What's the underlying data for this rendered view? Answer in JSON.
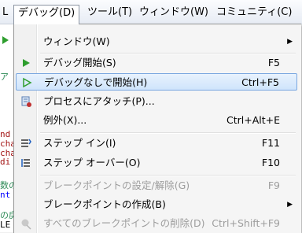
{
  "menubar": {
    "items": [
      "デバッグ(D)",
      "ツール(T)",
      "ウィンドウ(W)",
      "コミュニティ(C)"
    ],
    "partial_left": "L"
  },
  "editor_fragments": [
    "ア",
    "nd",
    "cha",
    "cha",
    "di",
    "数の",
    "nt",
    "の戻",
    "LE"
  ],
  "menu": {
    "items": [
      {
        "label": "ウィンドウ(W)",
        "shortcut": "",
        "submenu": true,
        "disabled": false
      },
      {
        "label": "デバッグ開始(S)",
        "shortcut": "F5",
        "disabled": false
      },
      {
        "label": "デバッグなしで開始(H)",
        "shortcut": "Ctrl+F5",
        "disabled": false,
        "highlighted": true
      },
      {
        "label": "プロセスにアタッチ(P)...",
        "shortcut": "",
        "disabled": false
      },
      {
        "label": "例外(X)...",
        "shortcut": "Ctrl+Alt+E",
        "disabled": false
      },
      {
        "label": "ステップ イン(I)",
        "shortcut": "F11",
        "disabled": false
      },
      {
        "label": "ステップ オーバー(O)",
        "shortcut": "F10",
        "disabled": false
      },
      {
        "label": "ブレークポイントの設定/解除(G)",
        "shortcut": "F9",
        "disabled": true
      },
      {
        "label": "ブレークポイントの作成(B)",
        "shortcut": "",
        "submenu": true,
        "disabled": false
      },
      {
        "label": "すべてのブレークポイントの削除(D)",
        "shortcut": "Ctrl+Shift+F9",
        "disabled": true
      }
    ]
  },
  "colors": {
    "menu_bg": "#f5f5f5",
    "highlight_border": "#7aa7e0",
    "disabled_text": "#9d9d9d",
    "run_icon": "#2e9e2e"
  },
  "icons": [
    "play-icon",
    "play-outline-icon",
    "attach-process-icon",
    "step-into-icon",
    "step-over-icon",
    "breakpoint-delete-icon",
    "submenu-arrow-icon"
  ]
}
